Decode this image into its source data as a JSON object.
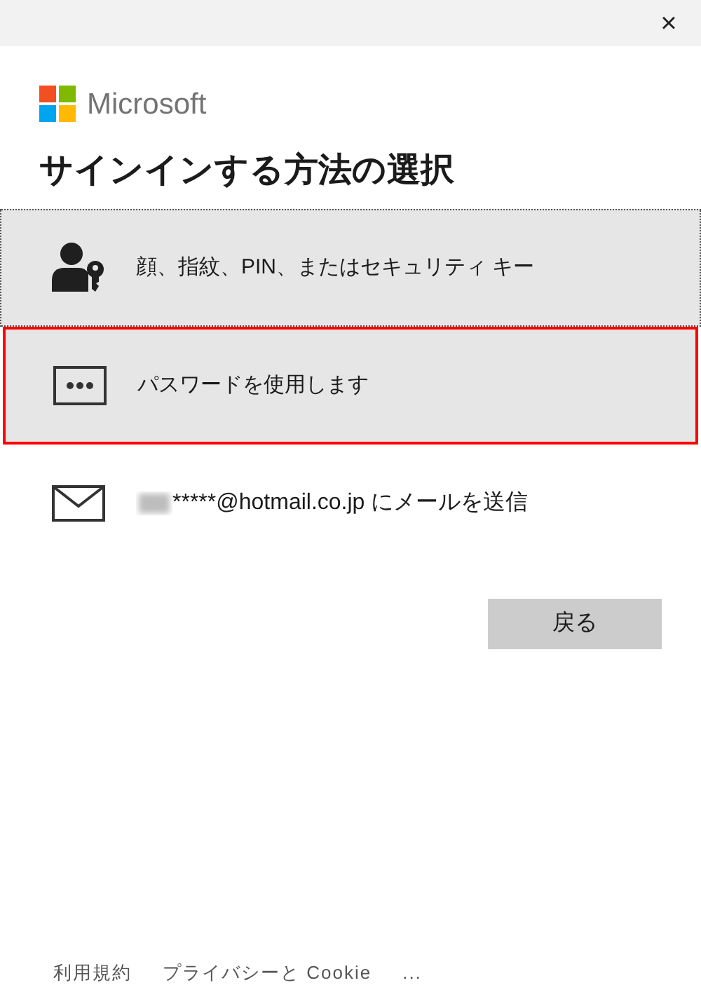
{
  "window": {
    "close": "×"
  },
  "brand": {
    "name": "Microsoft"
  },
  "title": "サインインする方法の選択",
  "options": [
    {
      "kind": "face_key",
      "label": "顔、指紋、PIN、またはセキュリティ キー",
      "focused": true,
      "highlighted": false
    },
    {
      "kind": "password",
      "label": "パスワードを使用します",
      "focused": false,
      "highlighted": true
    },
    {
      "kind": "email",
      "label": "*****@hotmail.co.jp にメールを送信",
      "focused": false,
      "highlighted": false
    }
  ],
  "back_button": "戻る",
  "footer": [
    "利用規約",
    "プライバシーと Cookie",
    "..."
  ]
}
